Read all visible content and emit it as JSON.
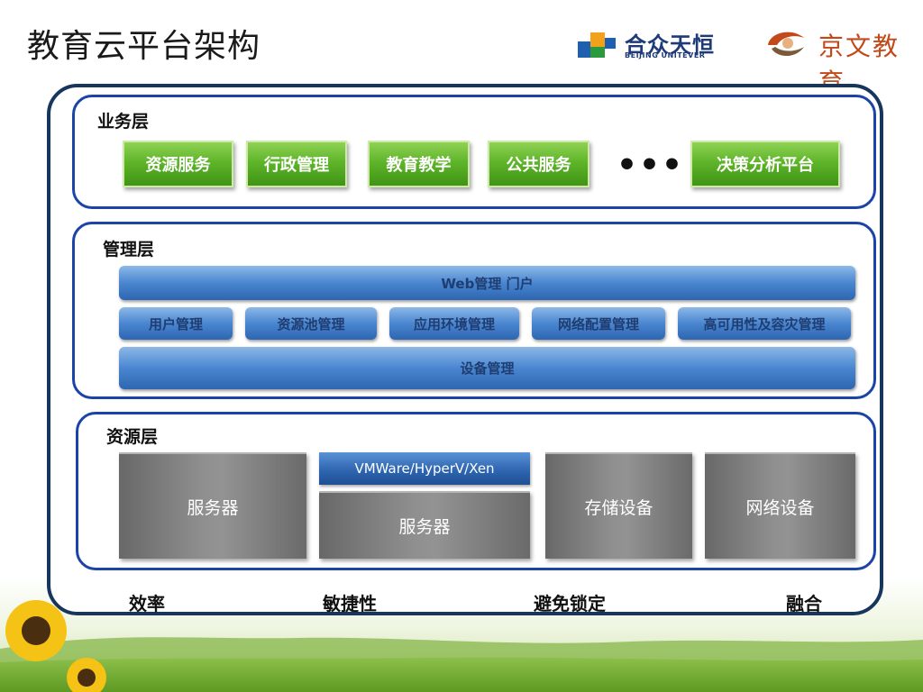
{
  "title": "教育云平台架构",
  "logos": {
    "unitever_cn": "合众天恒",
    "unitever_en": "BEIJING UNITEVER",
    "jingwen_cn": "京文教育"
  },
  "business_layer": {
    "label": "业务层",
    "items": [
      "资源服务",
      "行政管理",
      "教育教学",
      "公共服务",
      "决策分析平台"
    ],
    "ellipsis": "•••"
  },
  "management_layer": {
    "label": "管理层",
    "portal": "Web管理 门户",
    "items": [
      "用户管理",
      "资源池管理",
      "应用环境管理",
      "网络配置管理",
      "高可用性及容灾管理"
    ],
    "device": "设备管理"
  },
  "resource_layer": {
    "label": "资源层",
    "server1": "服务器",
    "hypervisor": "VMWare/HyperV/Xen",
    "server2": "服务器",
    "storage": "存储设备",
    "network": "网络设备"
  },
  "benefits": [
    "效率",
    "敏捷性",
    "避免锁定",
    "融合"
  ],
  "colors": {
    "frame": "#17365d",
    "layer_border": "#1b44a8",
    "green_button": "#5fb52a",
    "blue_bar": "#4a86d0",
    "gray_block": "#8f8f8f"
  }
}
